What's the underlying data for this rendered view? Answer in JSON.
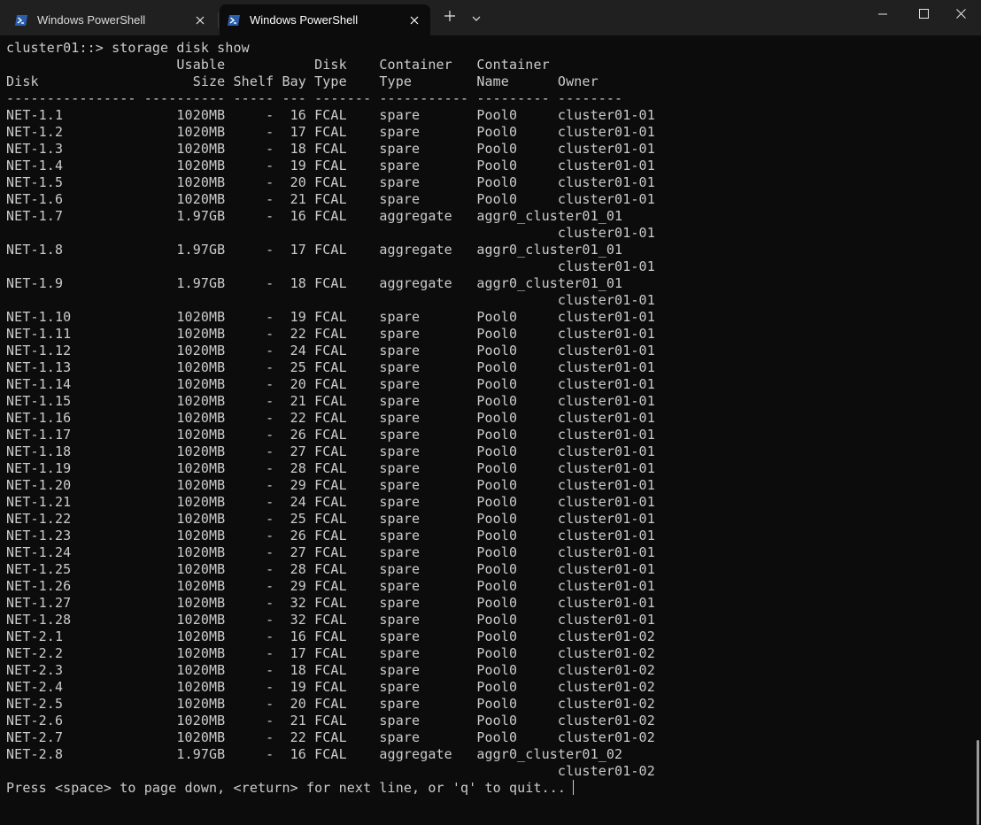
{
  "window": {
    "tabs": [
      {
        "title": "Windows PowerShell",
        "active": false
      },
      {
        "title": "Windows PowerShell",
        "active": true
      }
    ],
    "icons": {
      "tab": "powershell-icon",
      "close": "close-icon",
      "new_tab": "plus-icon",
      "dropdown": "chevron-down-icon",
      "minimize": "minimize-icon",
      "maximize": "maximize-icon",
      "window_close": "close-icon"
    },
    "colors": {
      "titlebar": "#202020",
      "terminal_bg": "#0c0c0c",
      "text": "#cccccc",
      "accent": "#2b5fae"
    }
  },
  "terminal": {
    "lines": [
      "cluster01::> storage disk show",
      "                     Usable           Disk    Container   Container",
      "Disk                   Size Shelf Bay Type    Type        Name      Owner",
      "---------------- ---------- ----- --- ------- ----------- --------- --------",
      "NET-1.1              1020MB     -  16 FCAL    spare       Pool0     cluster01-01",
      "NET-1.2              1020MB     -  17 FCAL    spare       Pool0     cluster01-01",
      "NET-1.3              1020MB     -  18 FCAL    spare       Pool0     cluster01-01",
      "NET-1.4              1020MB     -  19 FCAL    spare       Pool0     cluster01-01",
      "NET-1.5              1020MB     -  20 FCAL    spare       Pool0     cluster01-01",
      "NET-1.6              1020MB     -  21 FCAL    spare       Pool0     cluster01-01",
      "NET-1.7              1.97GB     -  16 FCAL    aggregate   aggr0_cluster01_01",
      "                                                                    cluster01-01",
      "NET-1.8              1.97GB     -  17 FCAL    aggregate   aggr0_cluster01_01",
      "                                                                    cluster01-01",
      "NET-1.9              1.97GB     -  18 FCAL    aggregate   aggr0_cluster01_01",
      "                                                                    cluster01-01",
      "NET-1.10             1020MB     -  19 FCAL    spare       Pool0     cluster01-01",
      "NET-1.11             1020MB     -  22 FCAL    spare       Pool0     cluster01-01",
      "NET-1.12             1020MB     -  24 FCAL    spare       Pool0     cluster01-01",
      "NET-1.13             1020MB     -  25 FCAL    spare       Pool0     cluster01-01",
      "NET-1.14             1020MB     -  20 FCAL    spare       Pool0     cluster01-01",
      "NET-1.15             1020MB     -  21 FCAL    spare       Pool0     cluster01-01",
      "NET-1.16             1020MB     -  22 FCAL    spare       Pool0     cluster01-01",
      "NET-1.17             1020MB     -  26 FCAL    spare       Pool0     cluster01-01",
      "NET-1.18             1020MB     -  27 FCAL    spare       Pool0     cluster01-01",
      "NET-1.19             1020MB     -  28 FCAL    spare       Pool0     cluster01-01",
      "NET-1.20             1020MB     -  29 FCAL    spare       Pool0     cluster01-01",
      "NET-1.21             1020MB     -  24 FCAL    spare       Pool0     cluster01-01",
      "NET-1.22             1020MB     -  25 FCAL    spare       Pool0     cluster01-01",
      "NET-1.23             1020MB     -  26 FCAL    spare       Pool0     cluster01-01",
      "NET-1.24             1020MB     -  27 FCAL    spare       Pool0     cluster01-01",
      "NET-1.25             1020MB     -  28 FCAL    spare       Pool0     cluster01-01",
      "NET-1.26             1020MB     -  29 FCAL    spare       Pool0     cluster01-01",
      "NET-1.27             1020MB     -  32 FCAL    spare       Pool0     cluster01-01",
      "NET-1.28             1020MB     -  32 FCAL    spare       Pool0     cluster01-01",
      "NET-2.1              1020MB     -  16 FCAL    spare       Pool0     cluster01-02",
      "NET-2.2              1020MB     -  17 FCAL    spare       Pool0     cluster01-02",
      "NET-2.3              1020MB     -  18 FCAL    spare       Pool0     cluster01-02",
      "NET-2.4              1020MB     -  19 FCAL    spare       Pool0     cluster01-02",
      "NET-2.5              1020MB     -  20 FCAL    spare       Pool0     cluster01-02",
      "NET-2.6              1020MB     -  21 FCAL    spare       Pool0     cluster01-02",
      "NET-2.7              1020MB     -  22 FCAL    spare       Pool0     cluster01-02",
      "NET-2.8              1.97GB     -  16 FCAL    aggregate   aggr0_cluster01_02",
      "                                                                    cluster01-02",
      "Press <space> to page down, <return> for next line, or 'q' to quit..."
    ]
  }
}
